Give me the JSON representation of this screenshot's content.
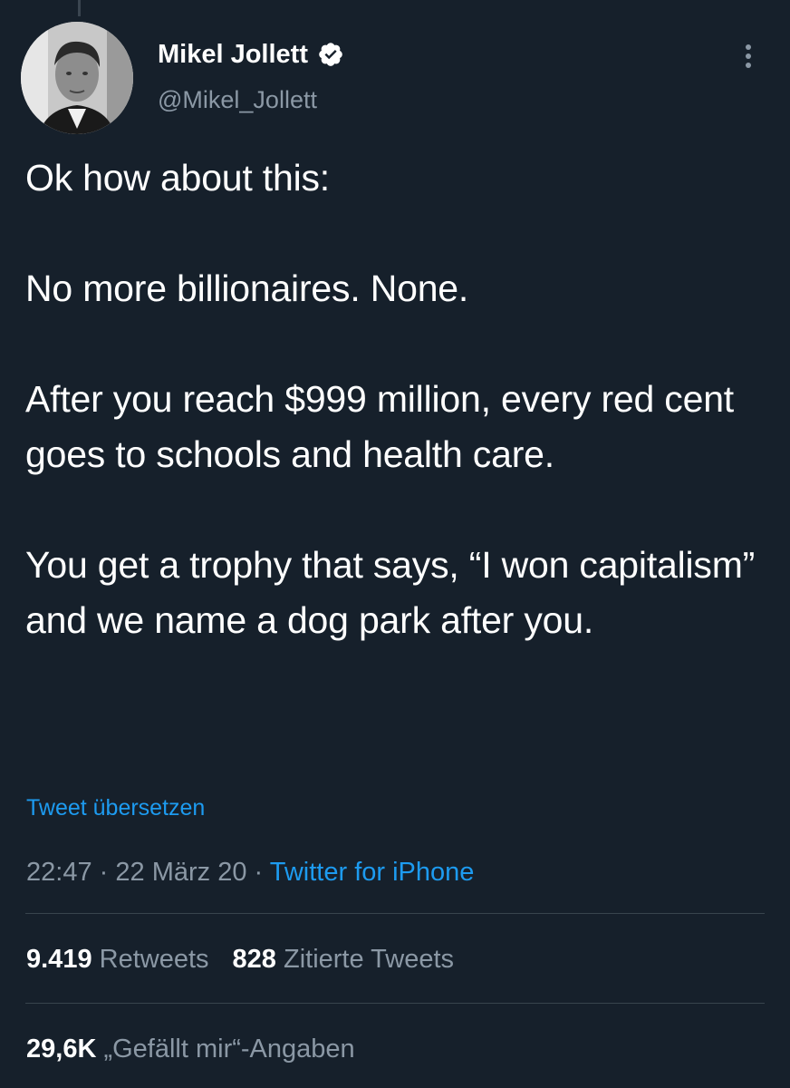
{
  "author": {
    "display_name": "Mikel Jollett",
    "handle": "@Mikel_Jollett",
    "verified": true
  },
  "tweet": {
    "text": "Ok how about this:\n\nNo more billionaires. None.\n\nAfter you reach $999 million, every red cent goes to schools and health care.\n\nYou get a trophy that says, “I won capitalism” and we name a dog park after you.",
    "translate_link": "Tweet übersetzen",
    "time": "22:47",
    "date": "22 März 20",
    "separator": "·",
    "source": "Twitter for iPhone"
  },
  "stats": {
    "retweets_count": "9.419",
    "retweets_label": "Retweets",
    "quotes_count": "828",
    "quotes_label": "Zitierte Tweets",
    "likes_count": "29,6K",
    "likes_label": "„Gefällt mir“-Angaben"
  },
  "colors": {
    "background": "#16202b",
    "accent": "#1d9bf0",
    "secondary_text": "#8b98a5"
  },
  "icons": {
    "verified": "verified-badge-icon",
    "more": "more-options-icon"
  }
}
